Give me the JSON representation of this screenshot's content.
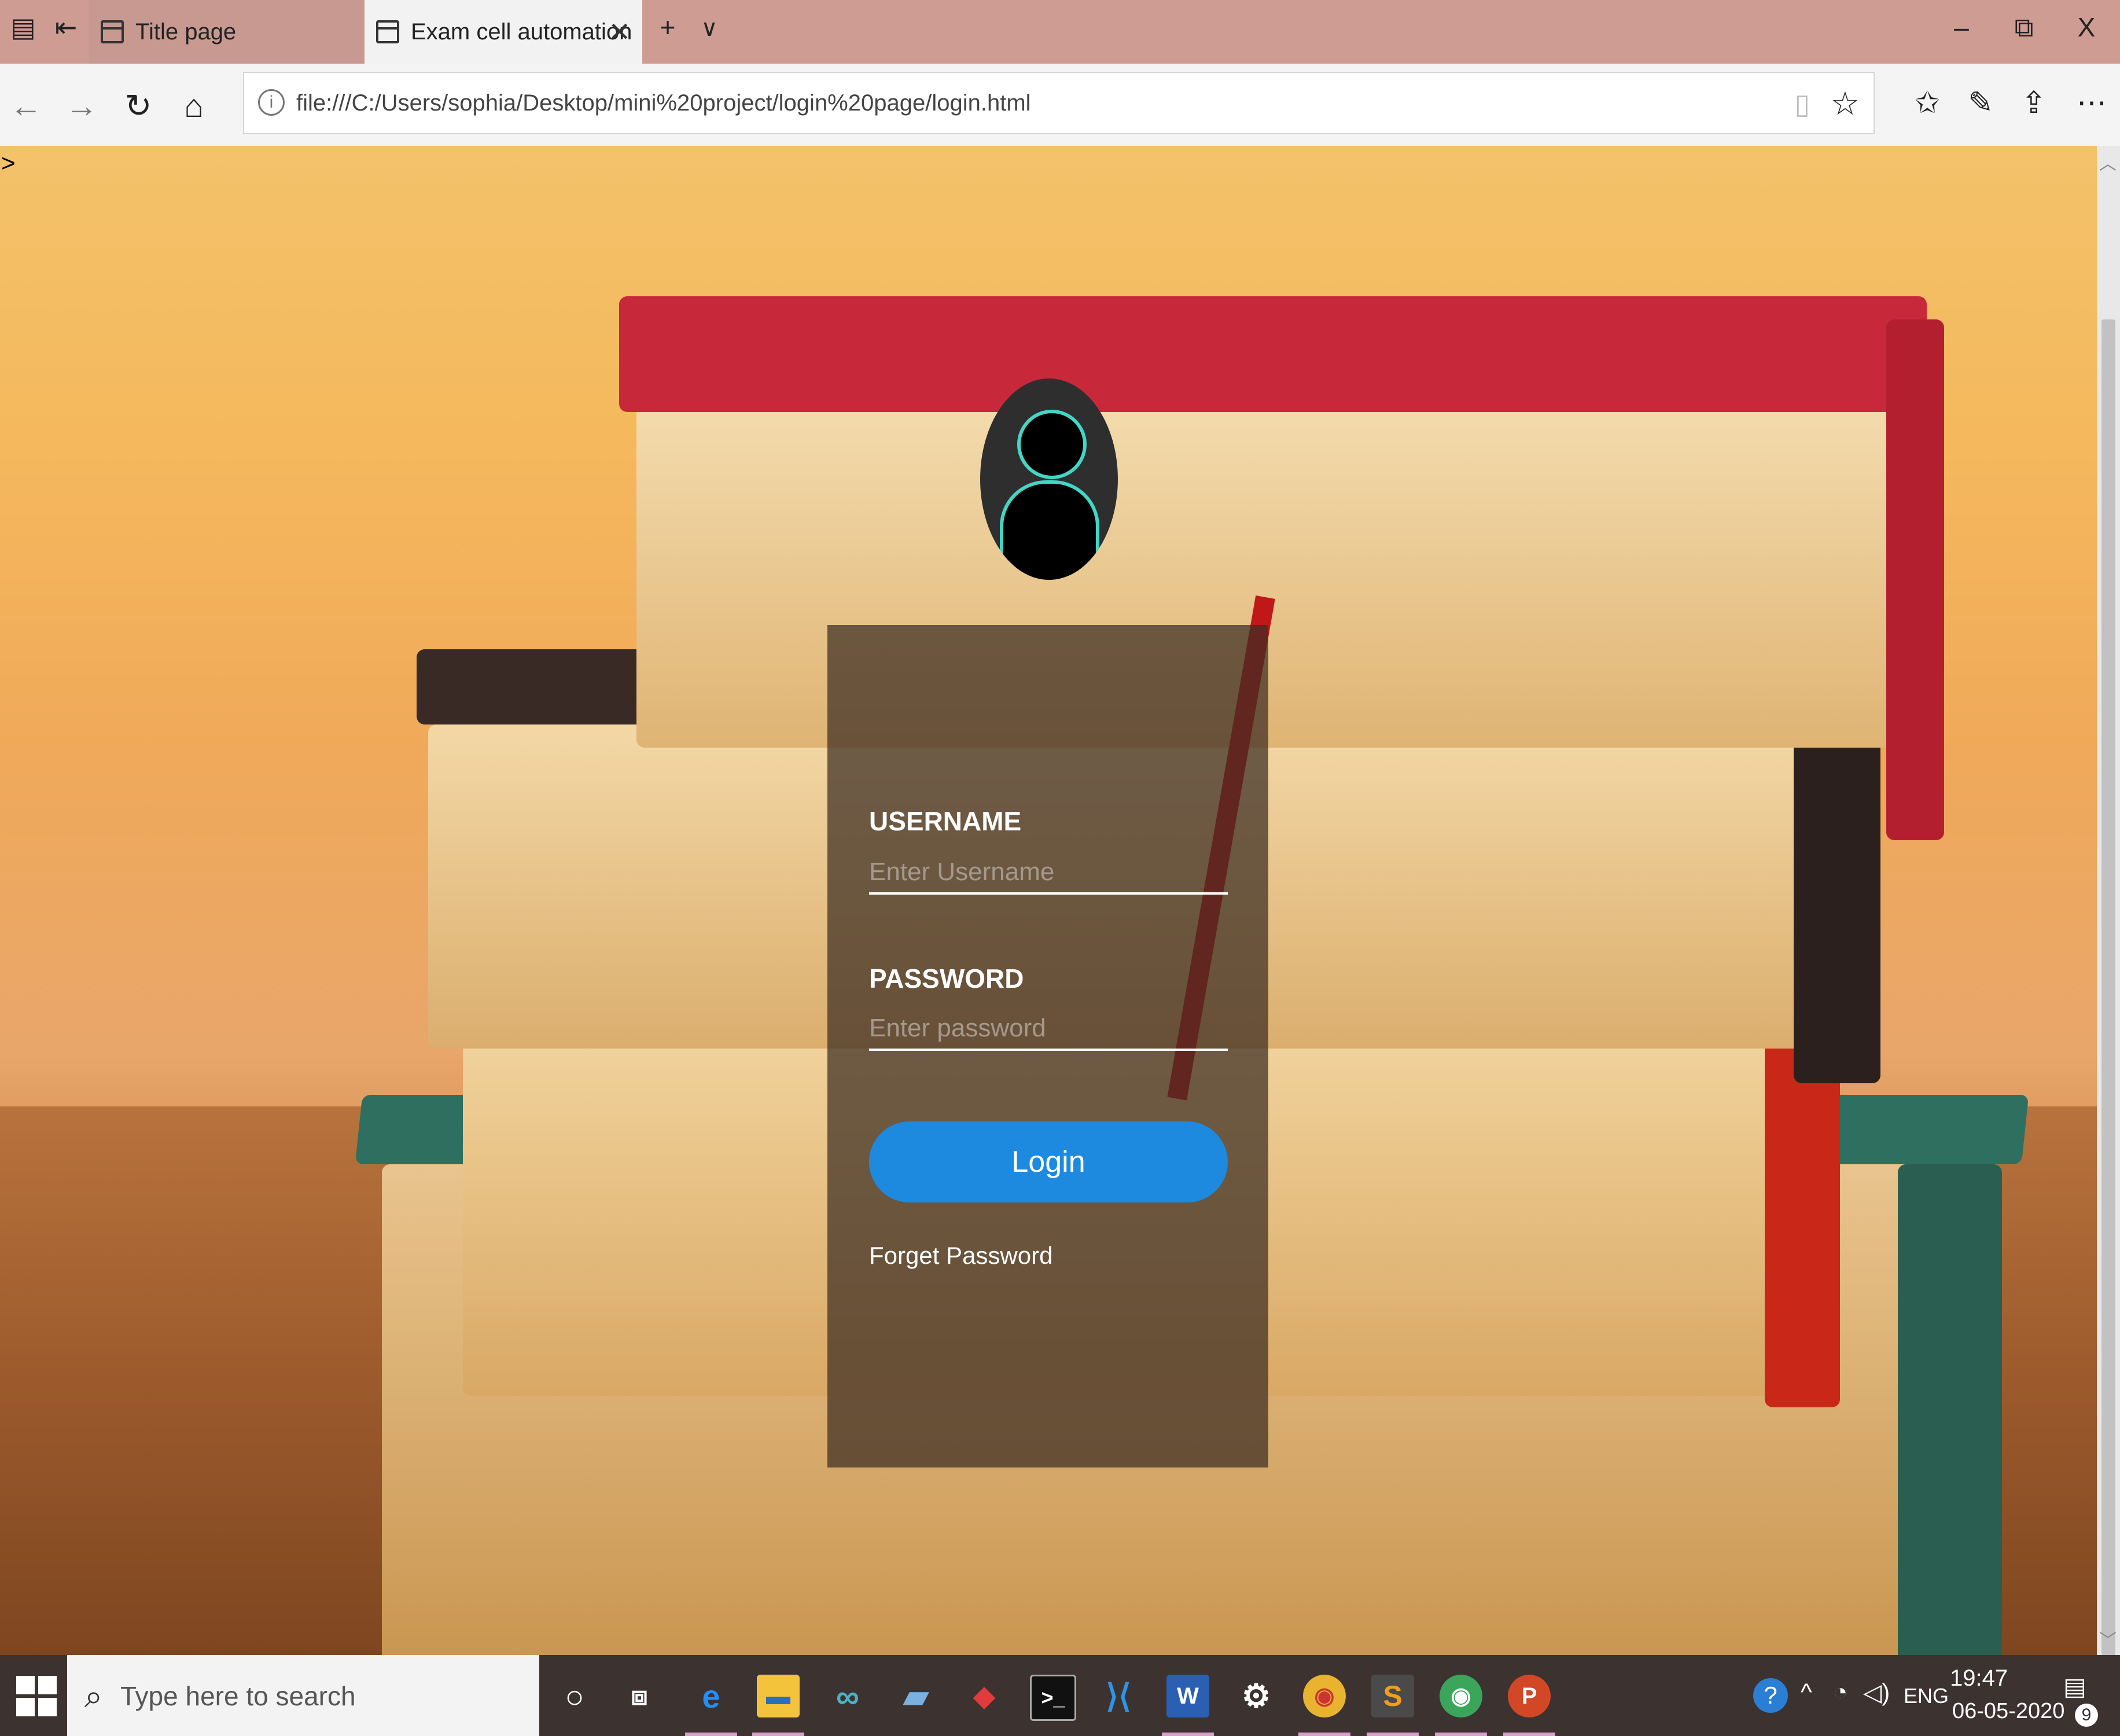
{
  "browser": {
    "tabs": [
      {
        "label": "Title page",
        "active": false
      },
      {
        "label": "Exam cell automation",
        "active": true
      }
    ],
    "new_tab_icon": "plus-icon",
    "tab_list_icon": "chevron-down-icon",
    "window_controls": {
      "minimize": "–",
      "restore": "⧉",
      "close": "X"
    },
    "url": "file:///C:/Users/sophia/Desktop/mini%20project/login%20page/login.html"
  },
  "page": {
    "stray_text": ">",
    "form": {
      "username_label": "USERNAME",
      "username_placeholder": "Enter Username",
      "password_label": "PASSWORD",
      "password_placeholder": "Enter password",
      "login_label": "Login",
      "forget_label": "Forget Password"
    },
    "colors": {
      "button": "#1d8ae0",
      "avatar_outline": "#43d6c6"
    }
  },
  "taskbar": {
    "search_placeholder": "Type here to search",
    "tray_language": "ENG",
    "time": "19:47",
    "date": "06-05-2020",
    "notification_count": "9"
  }
}
